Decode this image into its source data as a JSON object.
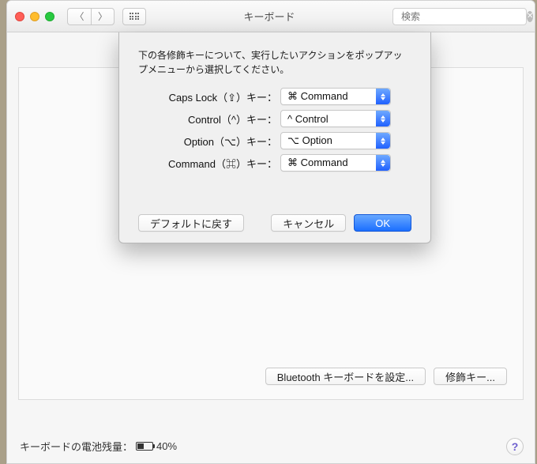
{
  "window": {
    "title": "キーボード",
    "search_placeholder": "検索"
  },
  "sheet": {
    "instruction": "下の各修飾キーについて、実行したいアクションをポップアップメニューから選択してください。",
    "rows": [
      {
        "label": "Caps Lock（⇪）キー：",
        "value": "⌘ Command"
      },
      {
        "label": "Control（^）キー：",
        "value": "^ Control"
      },
      {
        "label": "Option（⌥）キー：",
        "value": "⌥ Option"
      },
      {
        "label": "Command（⌘）キー：",
        "value": "⌘ Command"
      }
    ],
    "restore_defaults": "デフォルトに戻す",
    "cancel": "キャンセル",
    "ok": "OK"
  },
  "content": {
    "bluetooth_button": "Bluetooth キーボードを設定...",
    "modifier_button": "修飾キー..."
  },
  "footer": {
    "battery_label": "キーボードの電池残量：",
    "battery_percent": "40%"
  }
}
